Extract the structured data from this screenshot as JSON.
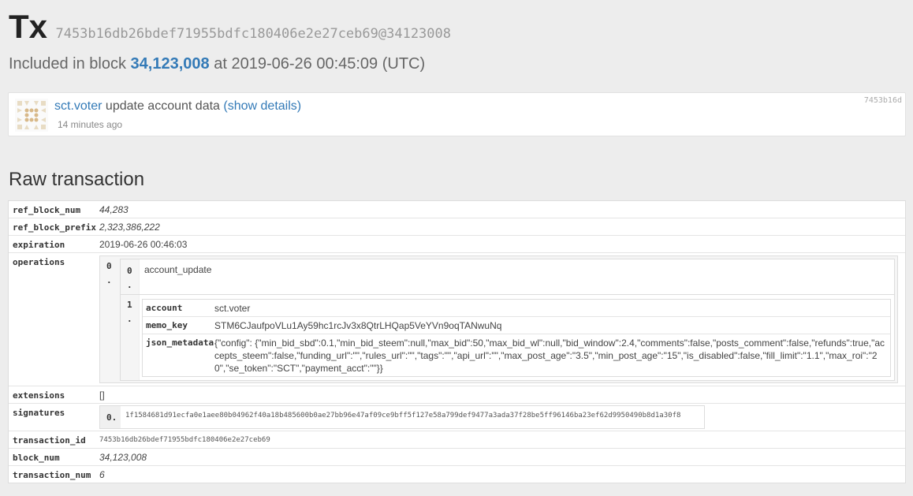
{
  "header": {
    "title": "Tx",
    "hash": "7453b16db26bdef71955bdfc180406e2e27ceb69",
    "at_block": "@34123008"
  },
  "included": {
    "prefix": "Included in block",
    "block": "34,123,008",
    "suffix": "at 2019-06-26 00:45:09 (UTC)"
  },
  "operation_card": {
    "account": "sct.voter",
    "action": "update account data",
    "show_details": "(show details)",
    "time": "14 minutes ago",
    "short_id": "7453b16d"
  },
  "raw_heading": "Raw transaction",
  "raw": {
    "ref_block_num": {
      "key": "ref_block_num",
      "value": "44,283"
    },
    "ref_block_prefix": {
      "key": "ref_block_prefix",
      "value": "2,323,386,222"
    },
    "expiration": {
      "key": "expiration",
      "value": "2019-06-26 00:46:03"
    },
    "operations": {
      "key": "operations",
      "outer_index": "0 .",
      "op_index": "0 .",
      "op_name": "account_update",
      "fields_index": "1 .",
      "fields": [
        {
          "key": "account",
          "value": "sct.voter"
        },
        {
          "key": "memo_key",
          "value": "STM6CJaufpoVLu1Ay59hc1rcJv3x8QtrLHQap5VeYVn9oqTANwuNq"
        },
        {
          "key": "json_metadata",
          "value": "{\"config\": {\"min_bid_sbd\":0.1,\"min_bid_steem\":null,\"max_bid\":50,\"max_bid_wl\":null,\"bid_window\":2.4,\"comments\":false,\"posts_comment\":false,\"refunds\":true,\"accepts_steem\":false,\"funding_url\":\"\",\"rules_url\":\"\",\"tags\":\"\",\"api_url\":\"\",\"max_post_age\":\"3.5\",\"min_post_age\":\"15\",\"is_disabled\":false,\"fill_limit\":\"1.1\",\"max_roi\":\"20\",\"se_token\":\"SCT\",\"payment_acct\":\"\"}}"
        }
      ]
    },
    "extensions": {
      "key": "extensions",
      "value": "[]"
    },
    "signatures": {
      "key": "signatures",
      "index": "0.",
      "value": "1f1584681d91ecfa0e1aee80b04962f40a18b485600b0ae27bb96e47af09ce9bff5f127e58a799def9477a3ada37f28be5ff96146ba23ef62d9950490b8d1a30f8"
    },
    "transaction_id": {
      "key": "transaction_id",
      "value": "7453b16db26bdef71955bdfc180406e2e27ceb69"
    },
    "block_num": {
      "key": "block_num",
      "value": "34,123,008"
    },
    "transaction_num": {
      "key": "transaction_num",
      "value": "6"
    }
  },
  "colors": {
    "link": "#337ab7",
    "background": "#ededed"
  },
  "icons": {
    "avatar": "identicon-avatar"
  }
}
